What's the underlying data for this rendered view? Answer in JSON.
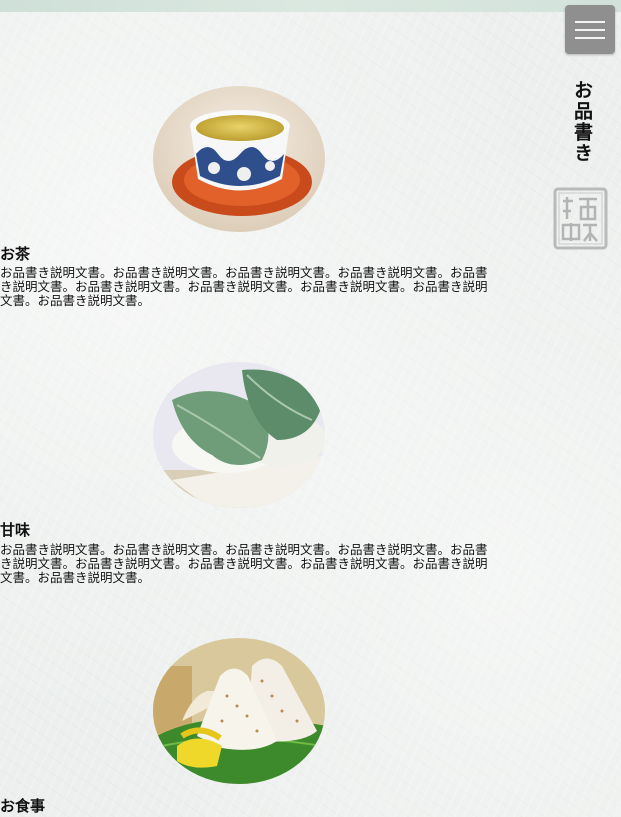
{
  "header": {
    "menu_icon": "hamburger-icon",
    "page_title": "お品書き",
    "seal_icon": "shop-seal-icon"
  },
  "menu_items": [
    {
      "title": "お茶",
      "photo_icon": "green-tea-cup-photo",
      "description": "お品書き説明文書。お品書き説明文書。お品書き説明文書。お品書き説明文書。お品書き説明文書。お品書き説明文書。お品書き説明文書。お品書き説明文書。お品書き説明文書。お品書き説明文書。"
    },
    {
      "title": "甘味",
      "photo_icon": "kashiwa-mochi-photo",
      "description": "お品書き説明文書。お品書き説明文書。お品書き説明文書。お品書き説明文書。お品書き説明文書。お品書き説明文書。お品書き説明文書。お品書き説明文書。お品書き説明文書。お品書き説明文書。"
    },
    {
      "title": "お食事",
      "photo_icon": "onigiri-photo",
      "description": ""
    }
  ]
}
